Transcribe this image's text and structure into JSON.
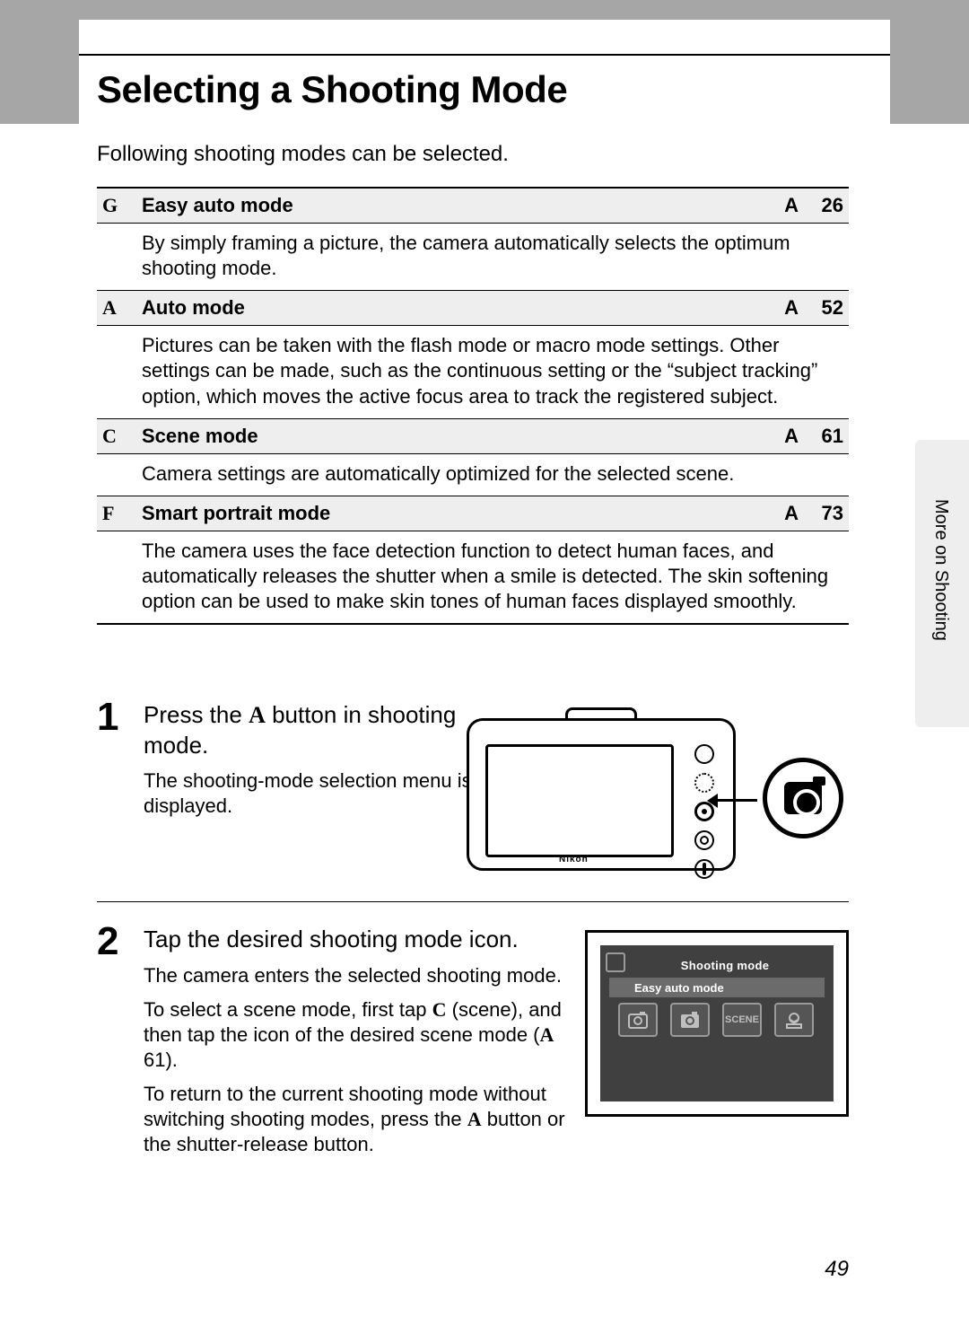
{
  "section_label": "More on Shooting",
  "page_title": "Selecting a Shooting Mode",
  "intro": "Following shooting modes can be selected.",
  "side_tab": "More on Shooting",
  "modes": [
    {
      "icon": "G",
      "name": "Easy auto mode",
      "ref": "A",
      "page": "26",
      "desc": "By simply framing a picture, the camera automatically selects the optimum shooting mode."
    },
    {
      "icon": "A",
      "name": "Auto mode",
      "ref": "A",
      "page": "52",
      "desc": "Pictures can be taken with the flash mode or macro mode settings. Other settings can be made, such as the continuous setting or the “subject tracking” option, which moves the active focus area to track the registered subject."
    },
    {
      "icon": "C",
      "name": "Scene mode",
      "ref": "A",
      "page": "61",
      "desc": "Camera settings are automatically optimized for the selected scene."
    },
    {
      "icon": "F",
      "name": "Smart portrait mode",
      "ref": "A",
      "page": "73",
      "desc": "The camera uses the face detection function to detect human faces, and automatically releases the shutter when a smile is detected. The skin softening option can be used to make skin tones of human faces displayed smoothly."
    }
  ],
  "step1": {
    "num": "1",
    "head_pre": "Press the ",
    "head_btn": "A",
    "head_post": " button in shooting mode.",
    "body": "The shooting-mode selection menu is displayed."
  },
  "step2": {
    "num": "2",
    "head": "Tap the desired shooting mode icon.",
    "p1": "The camera enters the selected shooting mode.",
    "p2_a": "To select a scene mode, first tap ",
    "p2_b": "C",
    "p2_c": " (scene), and then tap the icon of the desired scene mode (",
    "p2_d": "A",
    "p2_e": " 61).",
    "p3_a": "To return to the current shooting mode without switching shooting modes, press the ",
    "p3_b": "A",
    "p3_c": " button or the shutter-release button."
  },
  "lcd": {
    "title": "Shooting mode",
    "subtitle": "Easy auto mode",
    "icons": [
      "",
      "",
      "SCENE",
      ""
    ]
  },
  "camera_brand": "Nikon",
  "page_number": "49"
}
